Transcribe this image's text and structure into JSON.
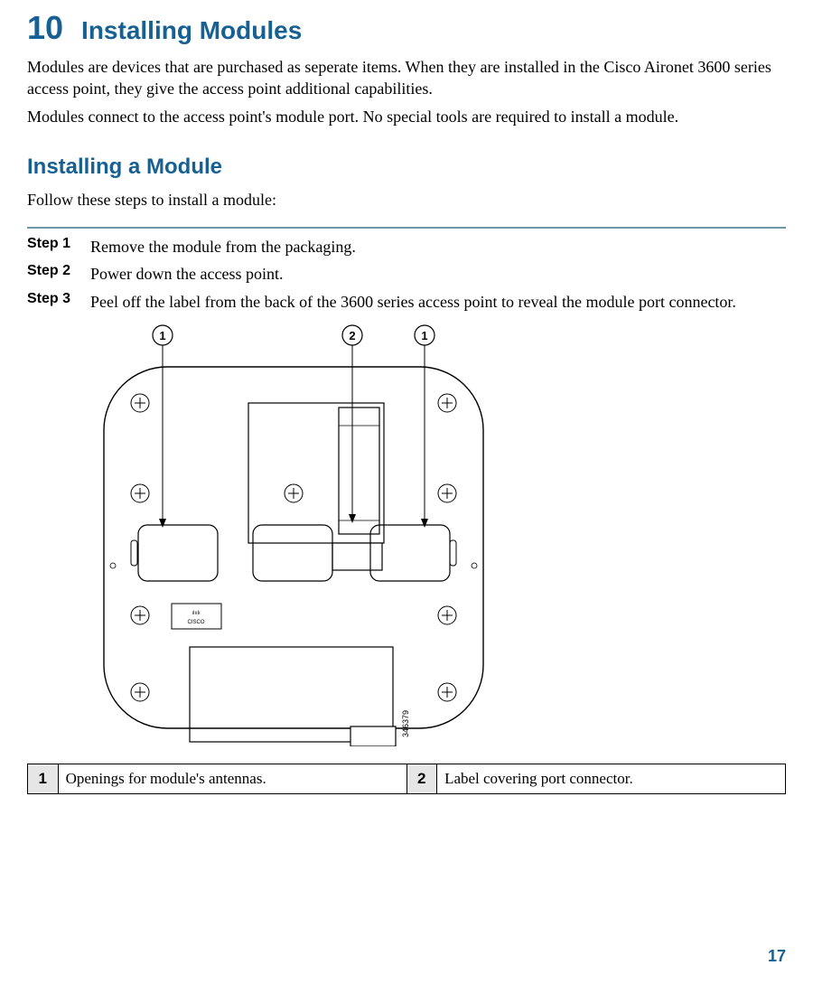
{
  "chapter": {
    "number": "10",
    "title": "Installing Modules"
  },
  "paragraphs": {
    "p1": "Modules are devices that are purchased as seperate items. When they are installed in the Cisco Aironet 3600 series access point, they give the access point additional capabilities.",
    "p2": "Modules connect to the access point's module port. No special tools are required to install a module."
  },
  "section": {
    "title": "Installing a Module",
    "intro": "Follow these steps to install a module:"
  },
  "steps": {
    "s1": {
      "label": "Step 1",
      "text": "Remove the module from the packaging."
    },
    "s2": {
      "label": "Step 2",
      "text": "Power down the access point."
    },
    "s3": {
      "label": "Step 3",
      "text": "Peel off the label from the back of the 3600 series access point to reveal the module port connector."
    }
  },
  "callouts": {
    "c1": "1",
    "c2": "2",
    "c1b": "1"
  },
  "diagram": {
    "refnum": "346379"
  },
  "legend": {
    "n1": "1",
    "t1": "Openings for module's antennas.",
    "n2": "2",
    "t2": "Label covering port connector."
  },
  "pagenum": "17"
}
